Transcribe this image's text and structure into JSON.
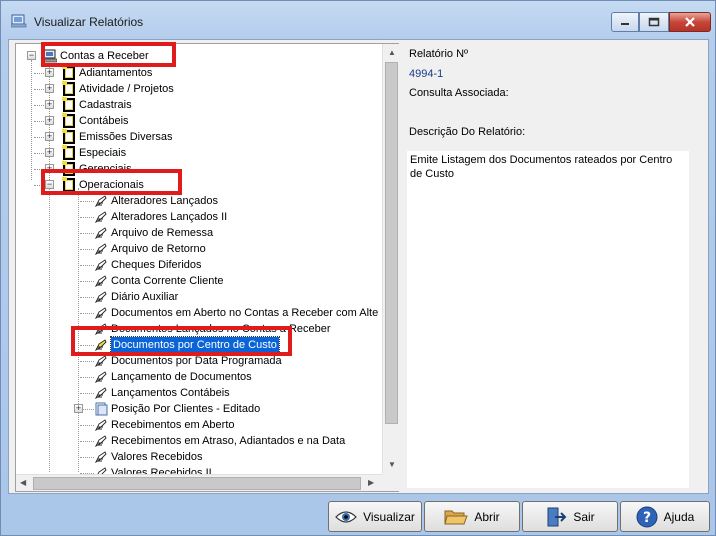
{
  "window": {
    "title": "Visualizar Relatórios"
  },
  "tree": {
    "root": "Contas a Receber",
    "categories": [
      "Adiantamentos",
      "Atividade / Projetos",
      "Cadastrais",
      "Contábeis",
      "Emissões Diversas",
      "Especiais",
      "Gerenciais"
    ],
    "expanded_category": "Operacionais",
    "reports": [
      "Alteradores  Lançados",
      "Alteradores  Lançados II",
      "Arquivo de Remessa",
      "Arquivo de Retorno",
      "Cheques Diferidos",
      "Conta Corrente Cliente",
      "Diário  Auxiliar",
      "Documentos em Aberto no Contas a Receber com Alte",
      "Documentos Lançados no Contas a Receber",
      "Documentos por Centro de Custo",
      "Documentos por Data Programada",
      "Lançamento  de Documentos",
      "Lançamentos Contábeis",
      "Posição Por Clientes - Editado",
      "Recebimentos em Aberto",
      "Recebimentos em Atraso, Adiantados e na Data",
      "Valores Recebidos",
      "Valores Recebidos II"
    ],
    "selected_index": 9,
    "expandable_report_index": 13
  },
  "details": {
    "report_no_label": "Relatório Nº",
    "report_no_value": "4994-1",
    "associated_label": "Consulta Associada:",
    "description_label": "Descrição Do Relatório:",
    "description_text": "Emite Listagem dos Documentos rateados por Centro de Custo"
  },
  "buttons": {
    "view": "Visualizar",
    "open": "Abrir",
    "exit": "Sair",
    "help": "Ajuda"
  },
  "colors": {
    "highlight": "#e01b1b",
    "selection": "#0a64d8"
  }
}
